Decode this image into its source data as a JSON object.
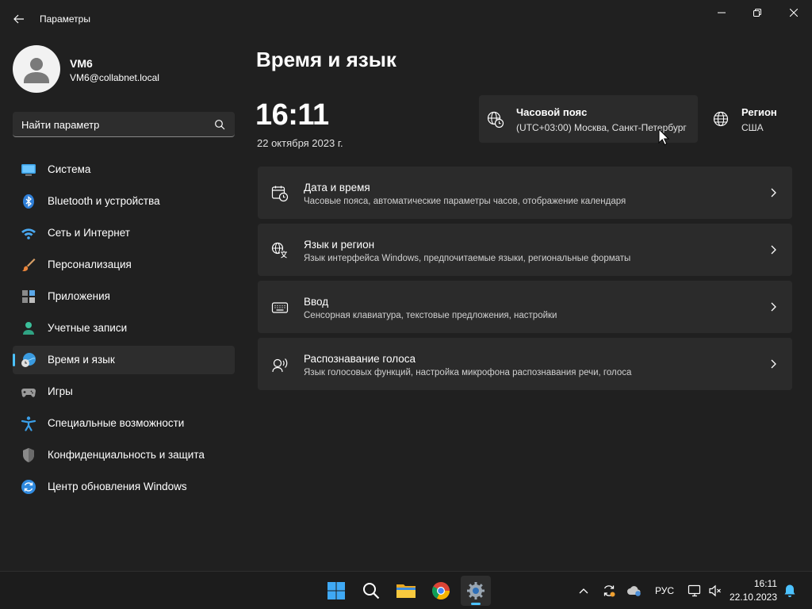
{
  "window": {
    "title": "Параметры"
  },
  "user": {
    "name": "VM6",
    "email": "VM6@collabnet.local"
  },
  "search": {
    "placeholder": "Найти параметр"
  },
  "nav": [
    {
      "label": "Система",
      "icon": "monitor-icon"
    },
    {
      "label": "Bluetooth и устройства",
      "icon": "bluetooth-icon"
    },
    {
      "label": "Сеть и Интернет",
      "icon": "wifi-icon"
    },
    {
      "label": "Персонализация",
      "icon": "brush-icon"
    },
    {
      "label": "Приложения",
      "icon": "apps-icon"
    },
    {
      "label": "Учетные записи",
      "icon": "person-icon"
    },
    {
      "label": "Время и язык",
      "icon": "time-language-icon",
      "active": true
    },
    {
      "label": "Игры",
      "icon": "gamepad-icon"
    },
    {
      "label": "Специальные возможности",
      "icon": "accessibility-icon"
    },
    {
      "label": "Конфиденциальность и защита",
      "icon": "shield-icon"
    },
    {
      "label": "Центр обновления Windows",
      "icon": "update-icon"
    }
  ],
  "main": {
    "title": "Время и язык",
    "clock": "16:11",
    "date": "22 октября 2023 г.",
    "timezone": {
      "title": "Часовой пояс",
      "value": "(UTC+03:00) Москва, Санкт-Петербург"
    },
    "region": {
      "title": "Регион",
      "value": "США"
    },
    "cards": [
      {
        "title": "Дата и время",
        "desc": "Часовые пояса, автоматические параметры часов, отображение календаря",
        "icon": "calendar-clock-icon"
      },
      {
        "title": "Язык и регион",
        "desc": "Язык интерфейса Windows, предпочитаемые языки, региональные форматы",
        "icon": "language-icon"
      },
      {
        "title": "Ввод",
        "desc": "Сенсорная клавиатура, текстовые предложения, настройки",
        "icon": "keyboard-icon"
      },
      {
        "title": "Распознавание голоса",
        "desc": "Язык голосовых функций, настройка микрофона распознавания речи, голоса",
        "icon": "voice-icon"
      }
    ]
  },
  "taskbar": {
    "apps": [
      "start-icon",
      "search-icon",
      "file-explorer-icon",
      "chrome-icon",
      "settings-icon"
    ],
    "active_app": "settings-icon",
    "language": "РУС",
    "time": "16:11",
    "date": "22.10.2023"
  },
  "colors": {
    "accent": "#4cc2ff",
    "background": "#202020",
    "card": "#2b2b2b"
  }
}
